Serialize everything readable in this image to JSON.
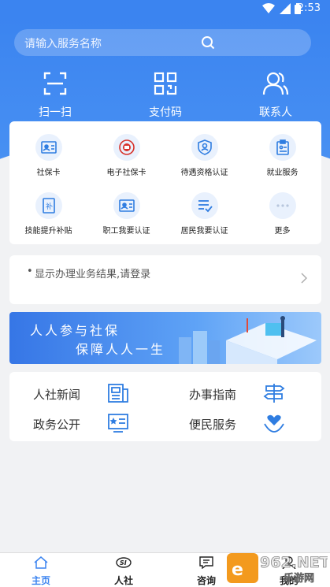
{
  "status_bar": {
    "time": "2:53"
  },
  "search": {
    "placeholder": "请输入服务名称"
  },
  "quick_actions": [
    {
      "label": "扫一扫",
      "icon": "scan-icon"
    },
    {
      "label": "支付码",
      "icon": "qrcode-icon"
    },
    {
      "label": "联系人",
      "icon": "contacts-icon"
    }
  ],
  "services": [
    {
      "label": "社保卡",
      "icon": "id-card-icon"
    },
    {
      "label": "电子社保卡",
      "icon": "e-social-card-icon"
    },
    {
      "label": "待遇资格认证",
      "icon": "shield-person-icon"
    },
    {
      "label": "就业服务",
      "icon": "clipboard-icon"
    },
    {
      "label": "技能提升补贴",
      "icon": "subsidy-icon"
    },
    {
      "label": "职工我要认证",
      "icon": "id-card-icon"
    },
    {
      "label": "居民我要认证",
      "icon": "checklist-icon"
    },
    {
      "label": "更多",
      "icon": "more-icon"
    }
  ],
  "notice": {
    "text": "显示办理业务结果,请登录"
  },
  "banner": {
    "line1": "人人参与社保",
    "line2": "保障人人一生"
  },
  "links": [
    {
      "label": "人社新闻",
      "icon": "news-icon"
    },
    {
      "label": "办事指南",
      "icon": "signpost-icon"
    },
    {
      "label": "政务公开",
      "icon": "notice-board-icon"
    },
    {
      "label": "便民服务",
      "icon": "heart-hand-icon"
    }
  ],
  "tabs": [
    {
      "label": "主页",
      "icon": "home-icon",
      "active": true
    },
    {
      "label": "人社",
      "icon": "si-logo-icon",
      "active": false
    },
    {
      "label": "咨询",
      "icon": "chat-icon",
      "active": false
    },
    {
      "label": "我的",
      "icon": "user-icon",
      "active": false
    }
  ],
  "watermark": {
    "text": "962.NET",
    "subtext": "乐游网"
  },
  "colors": {
    "primary": "#3b84f0",
    "icon_blue": "#2f7de1",
    "icon_bg": "#e9f1fd",
    "background": "#f1f2f4"
  }
}
